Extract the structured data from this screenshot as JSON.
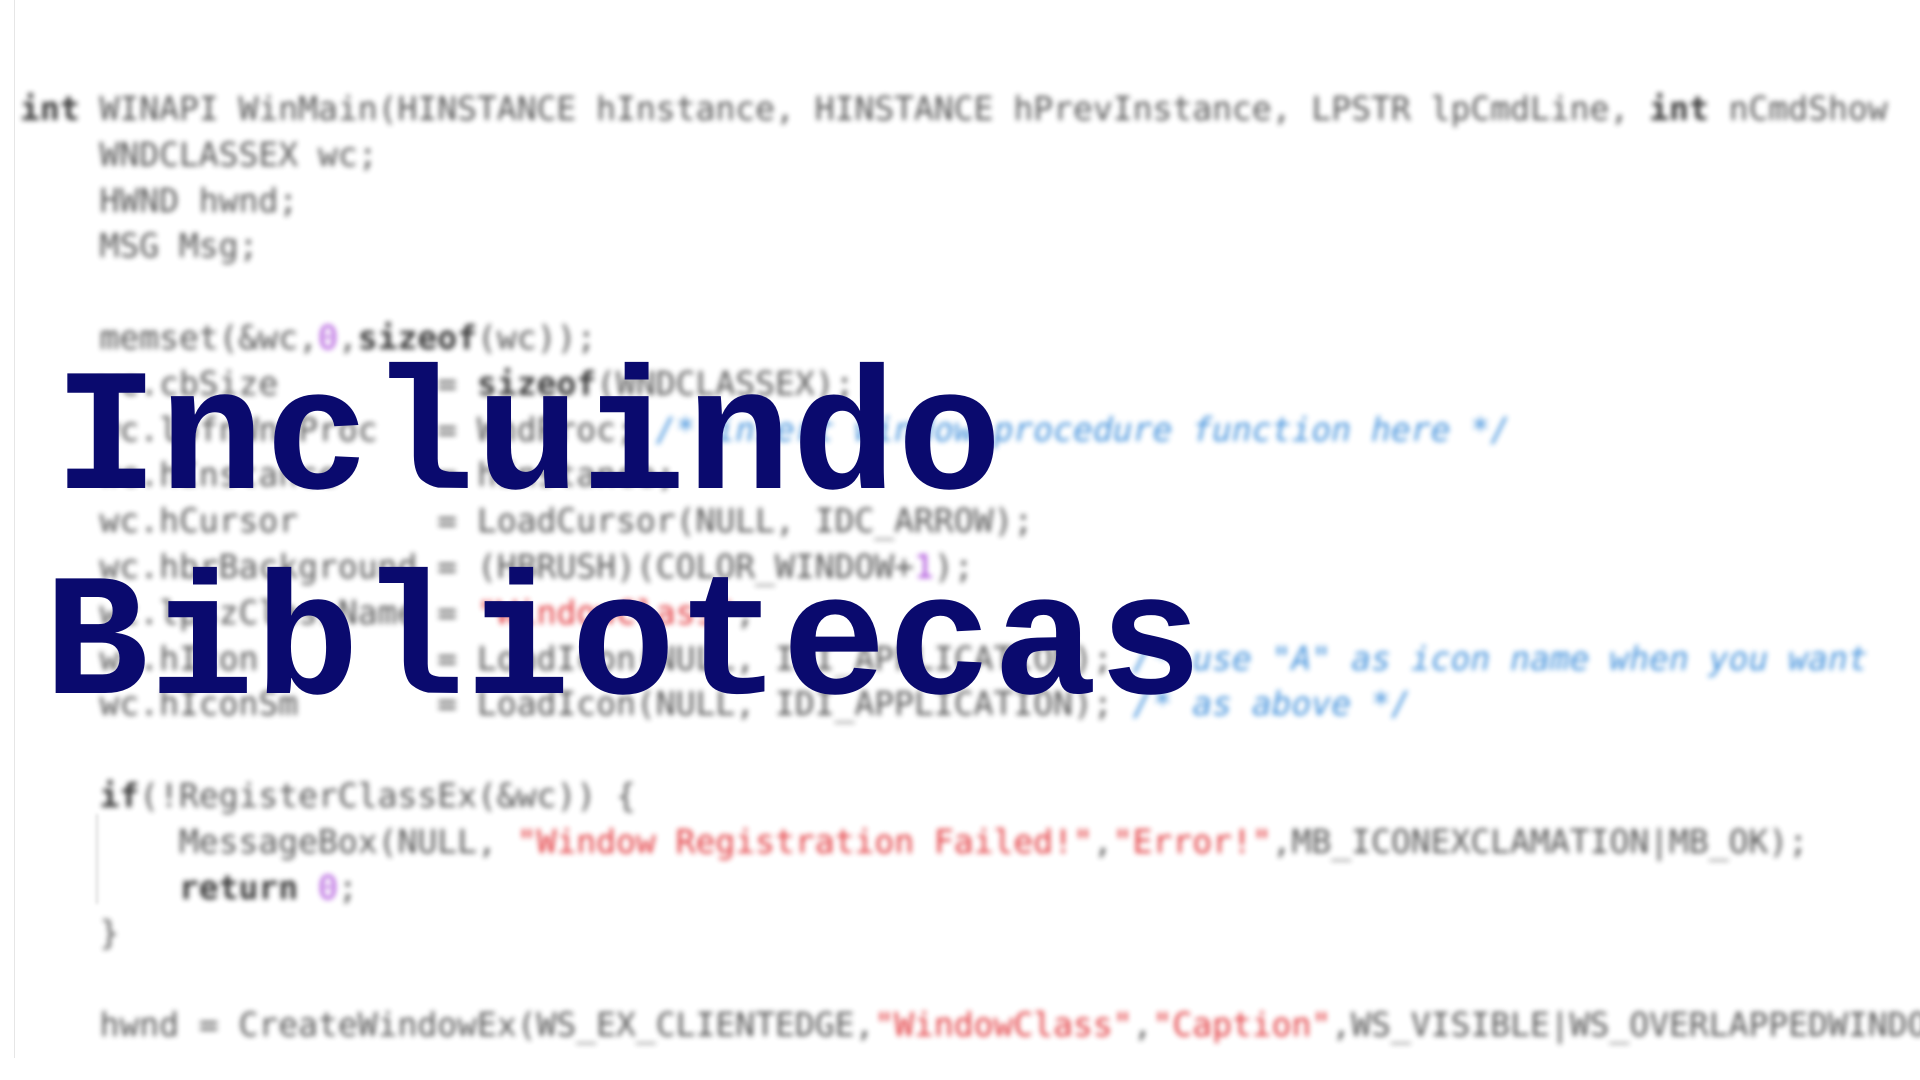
{
  "code_lines": [
    [
      [
        "kw",
        "int"
      ],
      [
        "id",
        " WINAPI WinMain(HINSTANCE hInstance, HINSTANCE hPrevInstance, LPSTR lpCmdLine, "
      ],
      [
        "kw",
        "int"
      ],
      [
        "id",
        " nCmdShow"
      ]
    ],
    [
      [
        "id",
        "    WNDCLASSEX wc;"
      ]
    ],
    [
      [
        "id",
        "    HWND hwnd;"
      ]
    ],
    [
      [
        "id",
        "    MSG Msg;"
      ]
    ],
    [],
    [
      [
        "id",
        "    memset(&wc,"
      ],
      [
        "num",
        "0"
      ],
      [
        "id",
        ","
      ],
      [
        "kw",
        "sizeof"
      ],
      [
        "id",
        "(wc));"
      ]
    ],
    [
      [
        "id",
        "    wc.cbSize        = "
      ],
      [
        "kw",
        "sizeof"
      ],
      [
        "id",
        "(WNDCLASSEX);"
      ]
    ],
    [
      [
        "id",
        "    wc.lpfnWndProc   = WndProc; "
      ],
      [
        "cmt",
        "/* insert window procedure function here */"
      ]
    ],
    [
      [
        "id",
        "    wc.hInstance     = hInstance;"
      ]
    ],
    [
      [
        "id",
        "    wc.hCursor       = LoadCursor(NULL, IDC_ARROW);"
      ]
    ],
    [
      [
        "id",
        "    wc.hbrBackground = (HBRUSH)(COLOR_WINDOW+"
      ],
      [
        "num",
        "1"
      ],
      [
        "id",
        ");"
      ]
    ],
    [
      [
        "id",
        "    wc.lpszClassName = "
      ],
      [
        "str",
        "\"WindowClass\""
      ],
      [
        "id",
        ";"
      ]
    ],
    [
      [
        "id",
        "    wc.hIcon         = LoadIcon(NULL, IDI_APPLICATION); "
      ],
      [
        "cmt",
        "/* use \"A\" as icon name when you want"
      ]
    ],
    [
      [
        "id",
        "    wc.hIconSm       = LoadIcon(NULL, IDI_APPLICATION); "
      ],
      [
        "cmt",
        "/* as above */"
      ]
    ],
    [],
    [
      [
        "kw",
        "    if"
      ],
      [
        "id",
        "(!RegisterClassEx(&wc)) {"
      ]
    ],
    [
      [
        "id",
        "        MessageBox(NULL, "
      ],
      [
        "str",
        "\"Window Registration Failed!\""
      ],
      [
        "id",
        ","
      ],
      [
        "str",
        "\"Error!\""
      ],
      [
        "id",
        ",MB_ICONEXCLAMATION|MB_OK);"
      ]
    ],
    [
      [
        "kw",
        "        return"
      ],
      [
        "id",
        " "
      ],
      [
        "num",
        "0"
      ],
      [
        "id",
        ";"
      ]
    ],
    [
      [
        "id",
        "    }"
      ]
    ],
    [],
    [
      [
        "id",
        "    hwnd = CreateWindowEx(WS_EX_CLIENTEDGE,"
      ],
      [
        "str",
        "\"WindowClass\""
      ],
      [
        "id",
        ","
      ],
      [
        "str",
        "\"Caption\""
      ],
      [
        "id",
        ",WS_VISIBLE|WS_OVERLAPPEDWINDOW"
      ]
    ]
  ],
  "title": {
    "line1": "Incluindo",
    "line2": "Bibliotecas"
  },
  "colors": {
    "title": "#0a0a6e",
    "keyword": "#222222",
    "string": "#e0262b",
    "number": "#a23ad6",
    "comment": "#2f86d8",
    "background": "#ffffff"
  }
}
